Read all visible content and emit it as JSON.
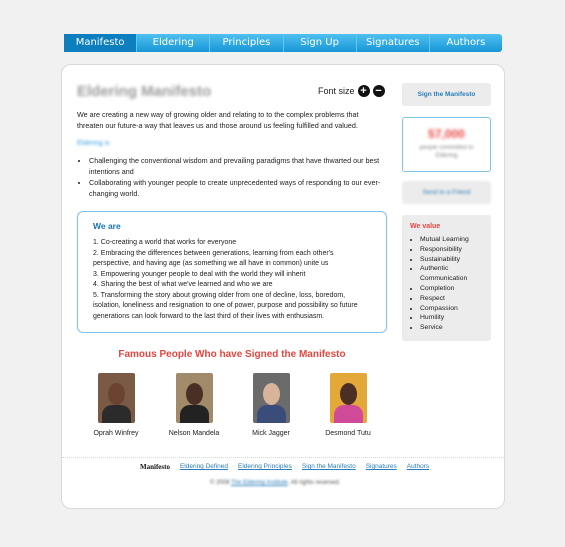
{
  "nav": [
    "Manifesto",
    "Eldering",
    "Principles",
    "Sign Up",
    "Signatures",
    "Authors"
  ],
  "page": {
    "title": "Eldering Manifesto",
    "font_size_label": "Font size",
    "font_increase": "+",
    "font_decrease": "−",
    "intro": "We are creating a new way of growing older and relating to to the complex problems that threaten our future-a way that leaves us and those around us feeling fulfilled and valued.",
    "subhead": "Eldering is",
    "bullets": [
      "Challenging the conventional wisdom and prevailing paradigms that have thwarted our best intentions and",
      "Collaborating with younger people to create unprecedented ways of responding to our ever-changing world."
    ]
  },
  "we_are": {
    "title": "We are",
    "items": [
      "1. Co-creating a world that works for everyone",
      "2. Embracing the differences between generations, learning from each other's perspective, and having age (as something we all have in common) unite us",
      "3. Empowering younger people to deal with the world they will inherit",
      "4. Sharing the best of what we've learned and who we are",
      "5. Transforming the story about growing older from one of decline, loss, boredom, isolation, loneliness and resignation to one of power, purpose and possibility so future generations can look forward to the last third of their lives with enthusiasm."
    ]
  },
  "famous": {
    "title": "Famous People Who have Signed the Manifesto",
    "people": [
      {
        "name": "Oprah Winfrey",
        "bg": "#7a5a44",
        "skin": "#6b4330",
        "cloth": "#2b2b2b"
      },
      {
        "name": "Nelson Mandela",
        "bg": "#a08a6a",
        "skin": "#4a3024",
        "cloth": "#222222"
      },
      {
        "name": "Mick Jagger",
        "bg": "#6b6b6b",
        "skin": "#d8b49a",
        "cloth": "#3a4c7a"
      },
      {
        "name": "Desmond Tutu",
        "bg": "#e4a83a",
        "skin": "#4b2f24",
        "cloth": "#d04a9a"
      }
    ]
  },
  "sidebar": {
    "sign_button": "Sign the Manifesto",
    "count": "57,000",
    "count_label_1": "people committed to",
    "count_label_2": "Eldering",
    "send_button": "Send to a Friend",
    "values_title": "We value",
    "values": [
      "Mutual Learning",
      "Responsibility",
      "Sustainability",
      "Authentic Communication",
      "Completion",
      "Respect",
      "Compassion",
      "Humility",
      "Service"
    ]
  },
  "footer": {
    "current": "Manifesto",
    "links": [
      "Eldering Defined",
      "Eldering Principles",
      "Sign the Manifesto",
      "Signatures",
      "Authors"
    ],
    "copyright_prefix": "© 2008",
    "copyright_org": "The Eldering Institute",
    "copyright_suffix": ". All rights reserved."
  },
  "colors": {
    "nav_gradient_top": "#4fc0ef",
    "nav_gradient_bottom": "#1796d6",
    "accent_red": "#e6453f",
    "accent_blue": "#1a73b8"
  }
}
